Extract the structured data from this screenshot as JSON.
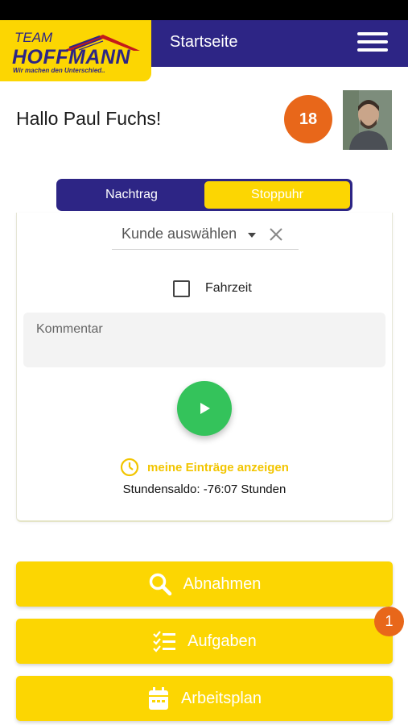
{
  "logo": {
    "team": "TEAM",
    "name": "HOFFMANN",
    "tagline": "Wir machen den Unterschied.."
  },
  "header": {
    "title": "Startseite",
    "menu_icon": "hamburger-menu-icon"
  },
  "greeting": "Hallo Paul Fuchs!",
  "notification_count": "18",
  "mode_toggle": {
    "tabs": [
      "Nachtrag",
      "Stoppuhr"
    ],
    "active": "Stoppuhr"
  },
  "timer_card": {
    "customer_select_label": "Kunde auswählen",
    "fahrzeit_label": "Fahrzeit",
    "fahrzeit_checked": false,
    "comment_placeholder": "Kommentar",
    "show_entries_label": "meine Einträge anzeigen",
    "balance_text": "Stundensaldo: -76:07 Stunden"
  },
  "actions": [
    {
      "label": "Abnahmen",
      "icon": "search-icon"
    },
    {
      "label": "Aufgaben",
      "icon": "checklist-icon",
      "badge": "1"
    },
    {
      "label": "Arbeitsplan",
      "icon": "calendar-icon"
    }
  ],
  "colors": {
    "primary": "#2d2585",
    "accent": "#fcd602",
    "badge": "#e8671a",
    "play": "#34c35b"
  }
}
